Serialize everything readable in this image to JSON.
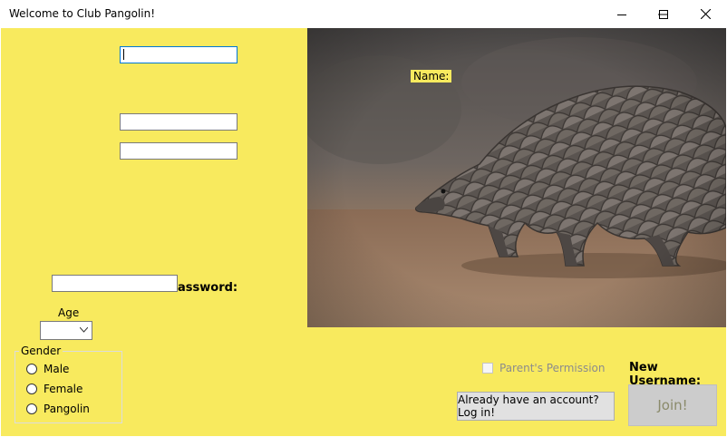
{
  "window": {
    "title": "Welcome to Club Pangolin!",
    "controls": [
      "minimize",
      "maximize",
      "close"
    ]
  },
  "form": {
    "name_field": {
      "value": "",
      "focused": true
    },
    "field_2": {
      "value": ""
    },
    "field_3": {
      "value": ""
    },
    "password_field": {
      "value": ""
    },
    "name_label": "Name:",
    "password_label": "assword:",
    "age_label": "Age",
    "age_select": {
      "value": ""
    },
    "gender": {
      "label": "Gender",
      "options": [
        "Male",
        "Female",
        "Pangolin"
      ]
    },
    "parent_permission": {
      "label": "Parent's Permission",
      "checked": false,
      "enabled": false
    },
    "new_username_label": "New Username:",
    "login_button": "Already have an account? Log in!",
    "join_button": "Join!"
  },
  "image": {
    "subject": "pangolin walking on dirt"
  }
}
